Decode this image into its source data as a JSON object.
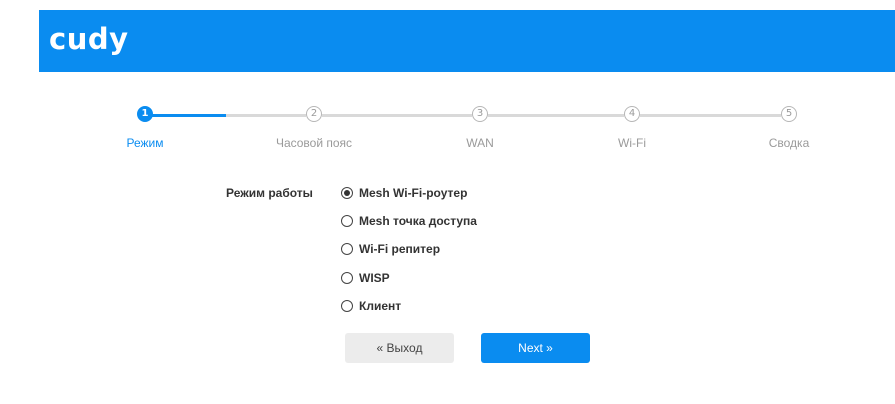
{
  "header": {
    "logo_text": "cudy",
    "bg_color": "#0a8cf0"
  },
  "stepper": {
    "accent_color": "#0a8cf0",
    "current_step": 1,
    "steps": [
      {
        "number": "1",
        "label": "Режим"
      },
      {
        "number": "2",
        "label": "Часовой пояс"
      },
      {
        "number": "3",
        "label": "WAN"
      },
      {
        "number": "4",
        "label": "Wi-Fi"
      },
      {
        "number": "5",
        "label": "Сводка"
      }
    ]
  },
  "form": {
    "mode_label": "Режим работы",
    "selected": "Mesh Wi-Fi-роутер",
    "options": [
      {
        "label": "Mesh Wi-Fi-роутер",
        "checked": true
      },
      {
        "label": "Mesh точка доступа",
        "checked": false
      },
      {
        "label": "Wi-Fi репитер",
        "checked": false
      },
      {
        "label": "WISP",
        "checked": false
      },
      {
        "label": "Клиент",
        "checked": false
      }
    ]
  },
  "buttons": {
    "exit_label": "« Выход",
    "next_label": "Next »"
  }
}
